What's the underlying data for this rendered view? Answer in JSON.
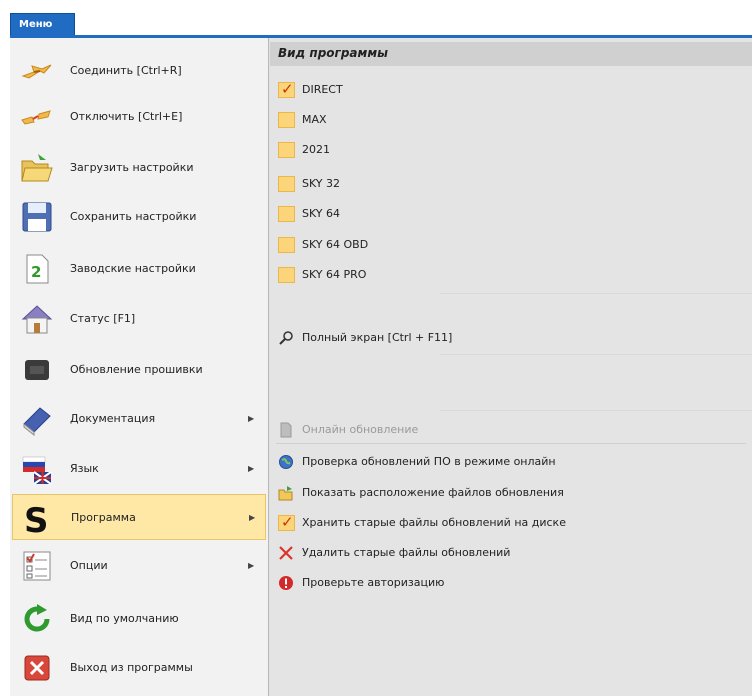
{
  "menu": {
    "tab_label": "Меню"
  },
  "left_menu": {
    "items": [
      {
        "label": "Соединить [Ctrl+R]",
        "icon": "connect-plug-icon",
        "has_submenu": false
      },
      {
        "label": "Отключить [Ctrl+E]",
        "icon": "disconnect-plug-icon",
        "has_submenu": false
      },
      {
        "label": "Загрузить настройки",
        "icon": "open-folder-icon",
        "has_submenu": false
      },
      {
        "label": "Сохранить настройки",
        "icon": "floppy-disk-icon",
        "has_submenu": false
      },
      {
        "label": "Заводские настройки",
        "icon": "factory-reset-icon",
        "has_submenu": false
      },
      {
        "label": "Статус [F1]",
        "icon": "home-icon",
        "has_submenu": false
      },
      {
        "label": "Обновление прошивки",
        "icon": "firmware-chip-icon",
        "has_submenu": false
      },
      {
        "label": "Документация",
        "icon": "book-icon",
        "has_submenu": true
      },
      {
        "label": "Язык",
        "icon": "language-flags-icon",
        "has_submenu": true
      },
      {
        "label": "Программа",
        "icon": "program-s-icon",
        "has_submenu": true,
        "active": true
      },
      {
        "label": "Опции",
        "icon": "options-checklist-icon",
        "has_submenu": true
      },
      {
        "label": "Вид по умолчанию",
        "icon": "reset-view-icon",
        "has_submenu": false
      },
      {
        "label": "Выход из программы",
        "icon": "exit-icon",
        "has_submenu": false
      }
    ]
  },
  "right_panel": {
    "header": "Вид программы",
    "view_options": [
      {
        "label": "DIRECT",
        "checked": true
      },
      {
        "label": "MAX",
        "checked": false
      },
      {
        "label": "2021",
        "checked": false
      },
      {
        "label": "SKY 32",
        "checked": false
      },
      {
        "label": "SKY 64",
        "checked": false
      },
      {
        "label": "SKY 64 OBD",
        "checked": false
      },
      {
        "label": "SKY 64 PRO",
        "checked": false
      }
    ],
    "fullscreen": {
      "label": "Полный экран [Ctrl + F11]",
      "icon": "magnifier-icon"
    },
    "update_items": [
      {
        "label": "Онлайн обновление",
        "icon": "document-icon",
        "disabled": true
      },
      {
        "label": "Проверка обновлений ПО в режиме онлайн",
        "icon": "globe-icon"
      },
      {
        "label": "Показать расположение файлов обновления",
        "icon": "folder-arrow-icon"
      },
      {
        "label": "Хранить старые файлы обновлений на диске",
        "icon": "checkmark-icon"
      },
      {
        "label": "Удалить старые файлы обновлений",
        "icon": "red-x-icon"
      },
      {
        "label": "Проверьте авторизацию",
        "icon": "alert-icon"
      }
    ]
  },
  "colors": {
    "accent": "#1f6cc2",
    "active_bg": "#ffe8a6",
    "checkbox": "#fcd57a",
    "check_mark": "#cc3300"
  }
}
